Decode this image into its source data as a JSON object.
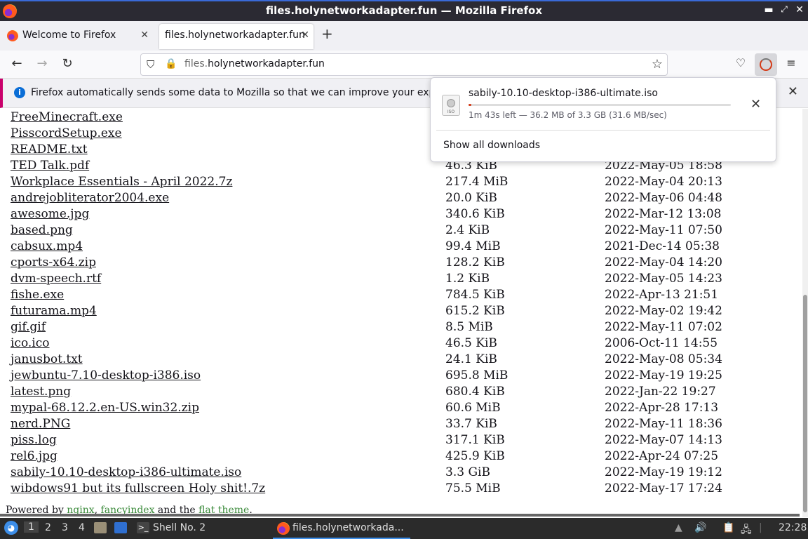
{
  "window": {
    "title": "files.holynetworkadapter.fun — Mozilla Firefox"
  },
  "tabs": [
    {
      "label": "Welcome to Firefox"
    },
    {
      "label": "files.holynetworkadapter.fun"
    }
  ],
  "urlbar": {
    "domain_sub": "files.",
    "domain_main": "holynetworkadapter.fun"
  },
  "notification": {
    "message": "Firefox automatically sends some data to Mozilla so that we can improve your experience."
  },
  "download": {
    "filename": "sabily-10.10-desktop-i386-ultimate.iso",
    "status": "1m 43s left — 36.2 MB of 3.3 GB (31.6 MB/sec)",
    "progress": 0.011,
    "show_all": "Show all downloads",
    "icon_label": "ISO"
  },
  "files": [
    {
      "name": "FreeMinecraft.exe",
      "size": "",
      "date": ""
    },
    {
      "name": "PisscordSetup.exe",
      "size": "",
      "date": ""
    },
    {
      "name": "README.txt",
      "size": "",
      "date": ""
    },
    {
      "name": "TED Talk.pdf",
      "size": "46.3 KiB",
      "date": "2022-May-05 18:58"
    },
    {
      "name": "Workplace Essentials - April 2022.7z",
      "size": "217.4 MiB",
      "date": "2022-May-04 20:13"
    },
    {
      "name": "andrejobliterator2004.exe",
      "size": "20.0 KiB",
      "date": "2022-May-06 04:48"
    },
    {
      "name": "awesome.jpg",
      "size": "340.6 KiB",
      "date": "2022-Mar-12 13:08"
    },
    {
      "name": "based.png",
      "size": "2.4 KiB",
      "date": "2022-May-11 07:50"
    },
    {
      "name": "cabsux.mp4",
      "size": "99.4 MiB",
      "date": "2021-Dec-14 05:38"
    },
    {
      "name": "cports-x64.zip",
      "size": "128.2 KiB",
      "date": "2022-May-04 14:20"
    },
    {
      "name": "dvm-speech.rtf",
      "size": "1.2 KiB",
      "date": "2022-May-05 14:23"
    },
    {
      "name": "fishe.exe",
      "size": "784.5 KiB",
      "date": "2022-Apr-13 21:51"
    },
    {
      "name": "futurama.mp4",
      "size": "615.2 KiB",
      "date": "2022-May-02 19:42"
    },
    {
      "name": "gif.gif",
      "size": "8.5 MiB",
      "date": "2022-May-11 07:02"
    },
    {
      "name": "ico.ico",
      "size": "46.5 KiB",
      "date": "2006-Oct-11 14:55"
    },
    {
      "name": "janusbot.txt",
      "size": "24.1 KiB",
      "date": "2022-May-08 05:34"
    },
    {
      "name": "jewbuntu-7.10-desktop-i386.iso",
      "size": "695.8 MiB",
      "date": "2022-May-19 19:25"
    },
    {
      "name": "latest.png",
      "size": "680.4 KiB",
      "date": "2022-Jan-22 19:27"
    },
    {
      "name": "mypal-68.12.2.en-US.win32.zip",
      "size": "60.6 MiB",
      "date": "2022-Apr-28 17:13"
    },
    {
      "name": "nerd.PNG",
      "size": "33.7 KiB",
      "date": "2022-May-11 18:36"
    },
    {
      "name": "piss.log",
      "size": "317.1 KiB",
      "date": "2022-May-07 14:13"
    },
    {
      "name": "rel6.jpg",
      "size": "425.9 KiB",
      "date": "2022-Apr-24 07:25"
    },
    {
      "name": "sabily-10.10-desktop-i386-ultimate.iso",
      "size": "3.3 GiB",
      "date": "2022-May-19 19:12"
    },
    {
      "name": "wibdows91 but its fullscreen Holy shit!.7z",
      "size": "75.5 MiB",
      "date": "2022-May-17 17:24"
    }
  ],
  "footer": {
    "prefix": "Powered by ",
    "link1": "nginx",
    "sep1": ", ",
    "link2": "fancyindex",
    "mid": " and the ",
    "link3": "flat theme",
    "suffix": "."
  },
  "taskbar": {
    "workspaces": [
      "1",
      "2",
      "3",
      "4"
    ],
    "shell_label": "Shell No. 2",
    "firefox_label": "files.holynetworkada...",
    "clock": "22:28"
  }
}
